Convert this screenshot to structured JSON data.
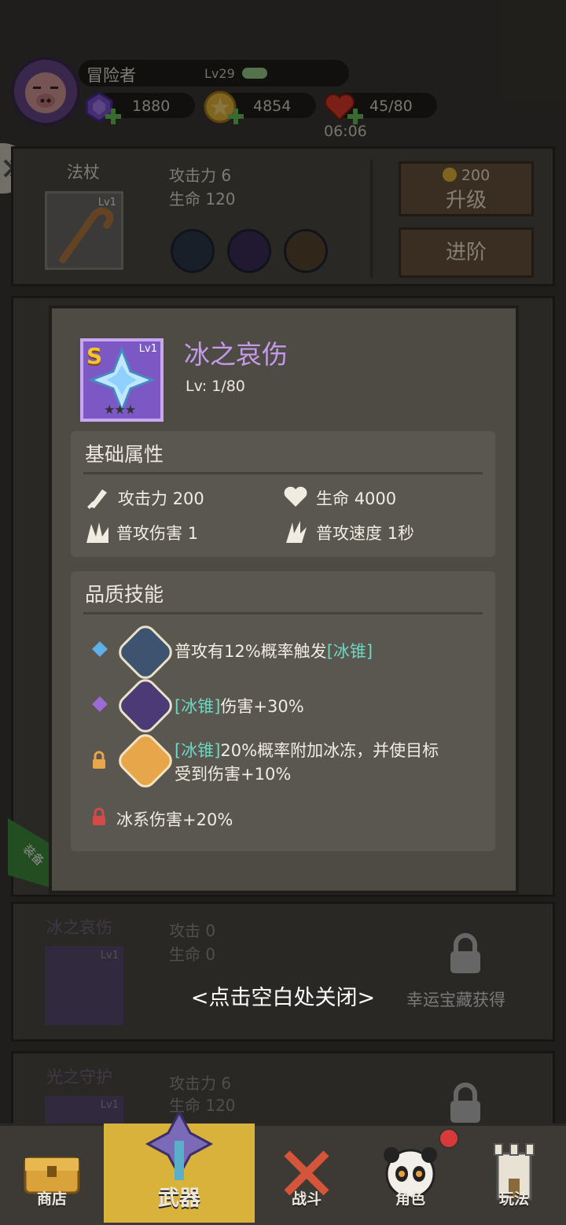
{
  "player": {
    "name": "冒险者",
    "level": "Lv29",
    "gems": "1880",
    "coins": "4854",
    "hearts": "45/80",
    "timer": "06:06"
  },
  "weapon_rows": [
    {
      "category": "法杖",
      "item_level": "Lv1",
      "attack": "攻击力 6",
      "hp": "生命 120",
      "upgrade_cost": "200",
      "upgrade_label": "升级",
      "advance_label": "进阶"
    },
    {
      "category": "冰之哀伤",
      "item_level": "Lv1",
      "attack": "攻击 0",
      "hp": "生命 0",
      "lock_text": "幸运宝藏获得"
    },
    {
      "category": "光之守护",
      "item_level": "Lv1",
      "attack": "攻击力 6",
      "hp": "生命 120"
    }
  ],
  "side_tab": "装备",
  "popup": {
    "rank": "S",
    "item_level": "Lv1",
    "name": "冰之哀伤",
    "level_text": "Lv: 1/80",
    "stars": 3,
    "base_title": "基础属性",
    "stats": [
      {
        "label": "攻击力",
        "value": "200"
      },
      {
        "label": "生命",
        "value": "4000"
      },
      {
        "label": "普攻伤害",
        "value": "1"
      },
      {
        "label": "普攻速度",
        "value": "1秒"
      }
    ],
    "quality_title": "品质技能",
    "skills": {
      "s1": {
        "prefix": "普攻有12%概率触发",
        "highlight": "[冰锥]"
      },
      "s2": {
        "highlight": "[冰锥]",
        "suffix": "伤害+30%"
      },
      "s3": {
        "highlight": "[冰锥]",
        "line1": "20%概率附加冰冻，并使目标",
        "line2": "受到伤害+10%"
      },
      "s4": {
        "text": "冰系伤害+20%"
      }
    },
    "colors": {
      "name": "#c49ae8",
      "highlight": "#6fd6c2",
      "diamond_blue": "#5fb0e8",
      "diamond_purple": "#9b6ad6",
      "lock_orange": "#e8a64a",
      "lock_red": "#d24a4a"
    }
  },
  "close_hint": "<点击空白处关闭>",
  "nav": [
    "商店",
    "武器",
    "战斗",
    "角色",
    "玩法"
  ]
}
